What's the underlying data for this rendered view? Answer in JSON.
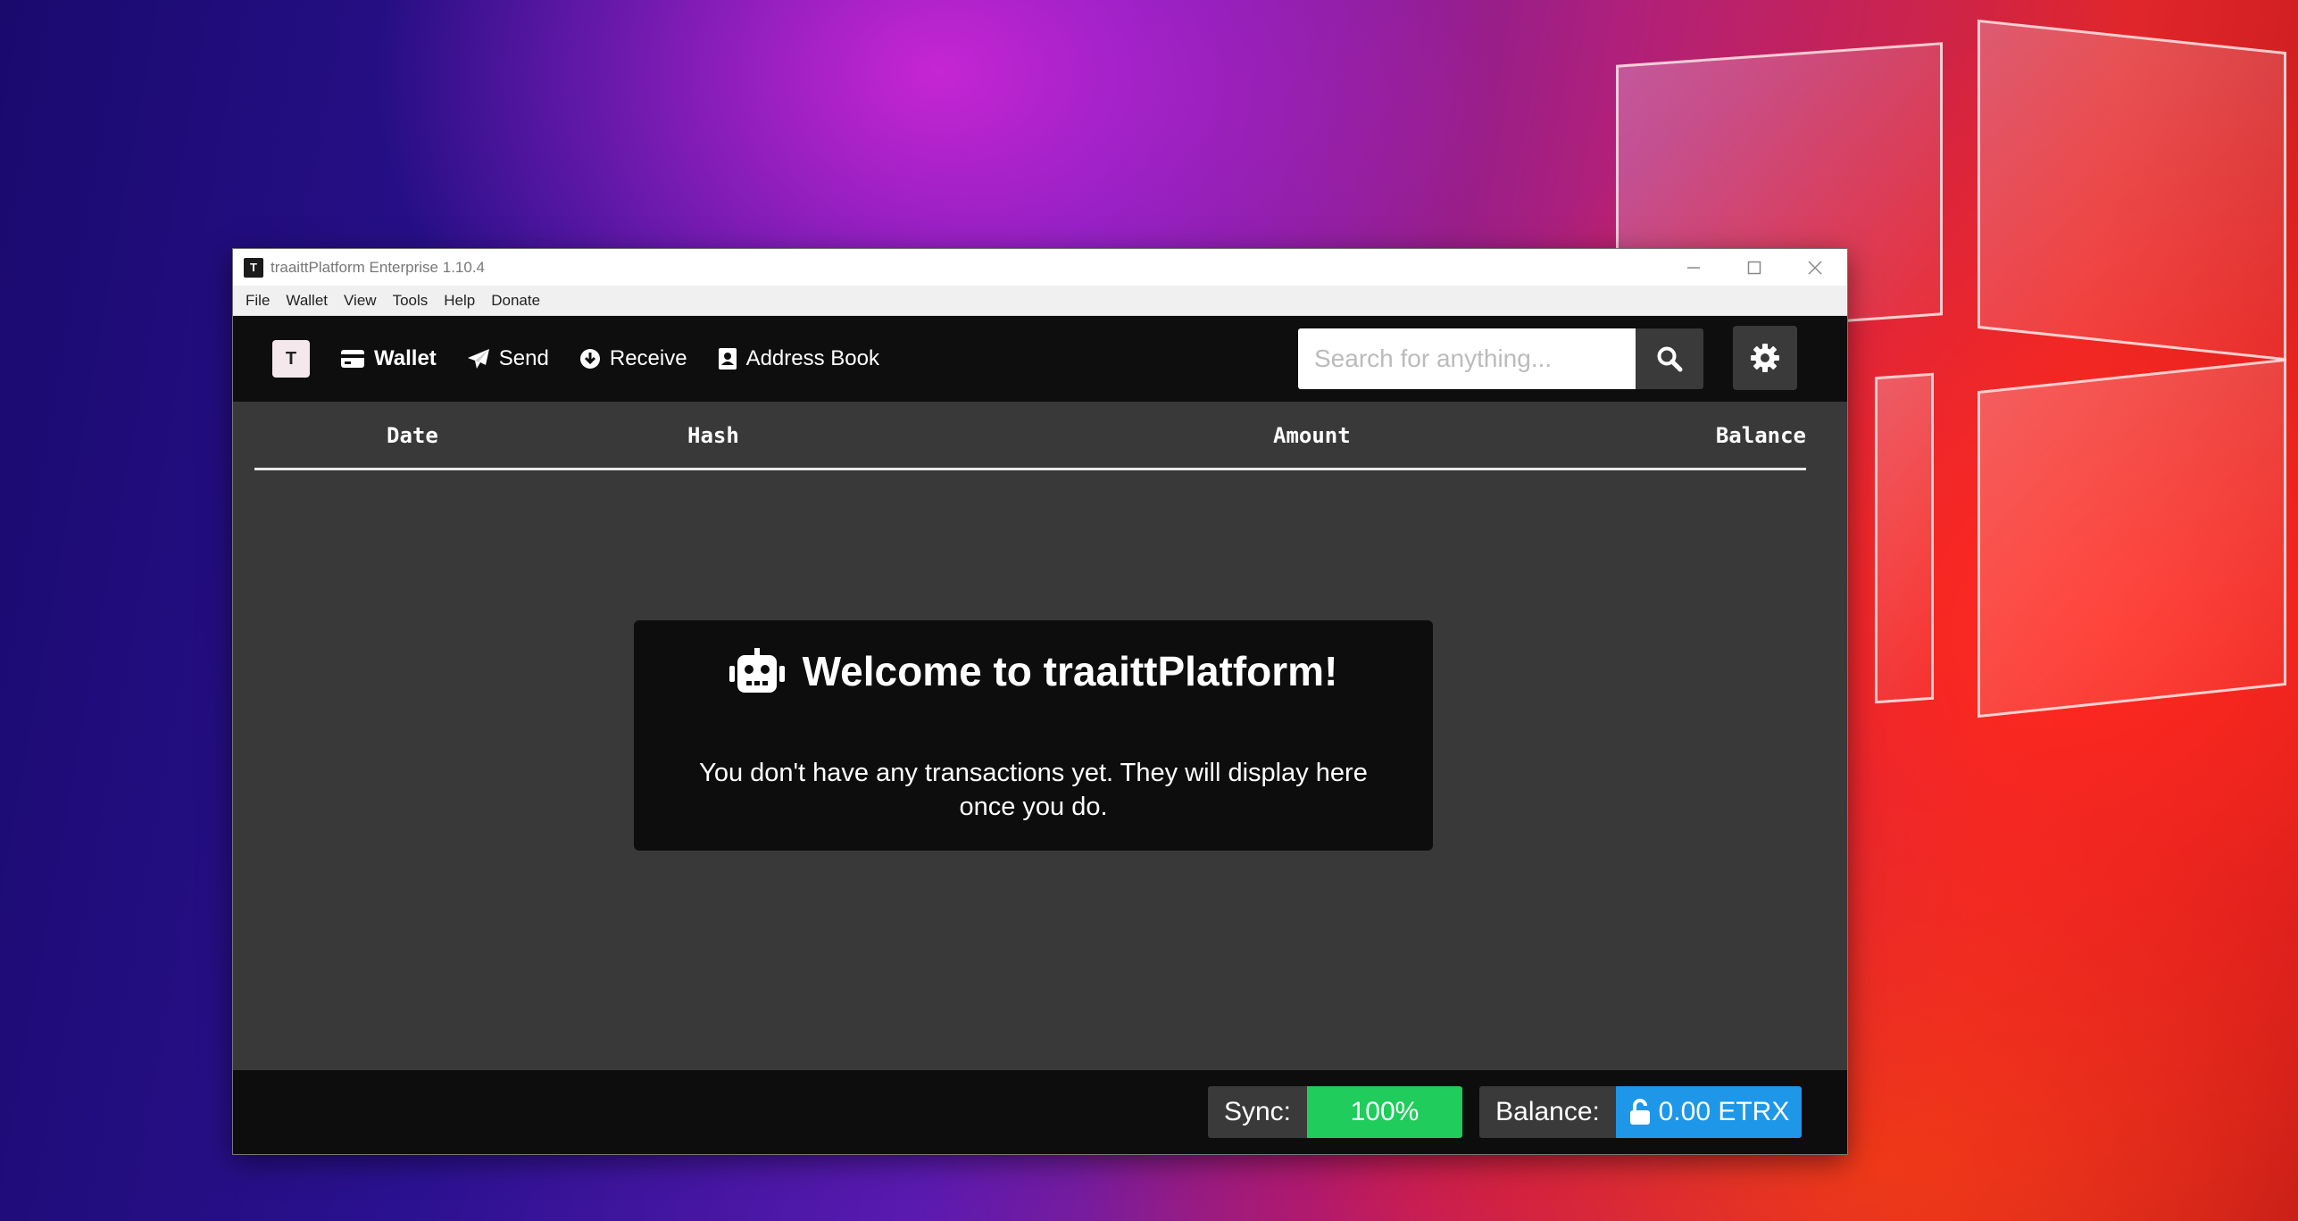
{
  "window": {
    "title": "traaittPlatform Enterprise 1.10.4",
    "controls": [
      "minimize-icon",
      "maximize-icon",
      "close-icon"
    ]
  },
  "menubar": {
    "items": [
      "File",
      "Wallet",
      "View",
      "Tools",
      "Help",
      "Donate"
    ]
  },
  "toolbar": {
    "logo_icon": "traaitt-logo-icon",
    "nav": [
      {
        "label": "Wallet",
        "icon": "wallet-icon",
        "active": true
      },
      {
        "label": "Send",
        "icon": "paper-plane-icon",
        "active": false
      },
      {
        "label": "Receive",
        "icon": "arrow-down-circle-icon",
        "active": false
      },
      {
        "label": "Address Book",
        "icon": "address-book-icon",
        "active": false
      }
    ],
    "search": {
      "placeholder": "Search for anything...",
      "value": "",
      "icon": "search-icon"
    },
    "settings_icon": "gear-icon"
  },
  "table": {
    "columns": [
      "Date",
      "Hash",
      "Amount",
      "Balance"
    ],
    "rows": []
  },
  "welcome": {
    "icon": "robot-icon",
    "title": "Welcome to traaittPlatform!",
    "message": "You don't have any transactions yet. They will display here once you do."
  },
  "status": {
    "sync_label": "Sync:",
    "sync_value": "100%",
    "sync_color": "#1fcc5c",
    "balance_label": "Balance:",
    "balance_value": "0.00 ETRX",
    "balance_icon": "unlock-icon",
    "balance_color": "#1f97e8"
  }
}
